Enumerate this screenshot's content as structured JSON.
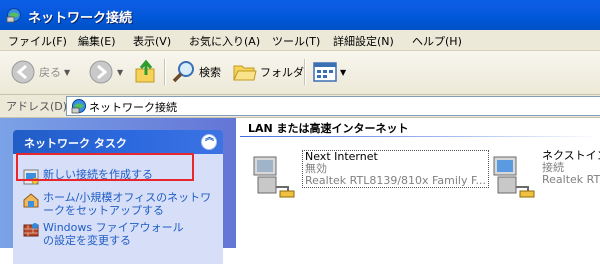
{
  "window": {
    "title": "ネットワーク接続"
  },
  "menu": [
    "ファイル(F)",
    "編集(E)",
    "表示(V)",
    "お気に入り(A)",
    "ツール(T)",
    "詳細設定(N)",
    "ヘルプ(H)"
  ],
  "toolbar": {
    "back_label": "戻る",
    "search_label": "検索",
    "folders_label": "フォルダ"
  },
  "address": {
    "label": "アドレス(D)",
    "value": "ネットワーク接続"
  },
  "tasks": {
    "title": "ネットワーク タスク",
    "items": [
      "新しい接続を作成する",
      "ホーム/小規模オフィスのネットワークをセットアップする",
      "Windows ファイアウォールの設定を変更する"
    ]
  },
  "content": {
    "group_title": "LAN または高速インターネット",
    "connections": [
      {
        "name": "Next Internet",
        "status": "無効",
        "device": "Realtek RTL8139/810x Family F..."
      },
      {
        "name": "ネクストインタ",
        "status": "接続",
        "device": "Realtek RTL"
      }
    ]
  },
  "colors": {
    "titlebar": "#0058d7",
    "task_link": "#215dc6",
    "highlight": "#e8262d",
    "pane": "#6375d6"
  }
}
